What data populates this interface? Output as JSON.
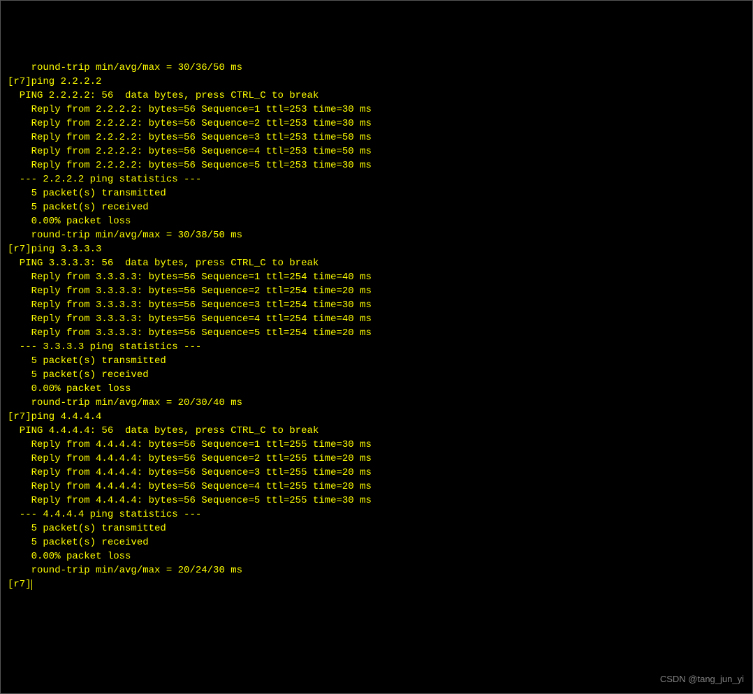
{
  "top_line": "    round-trip min/avg/max = 30/36/50 ms",
  "prompt_host": "r7",
  "pings": [
    {
      "cmd": "ping 2.2.2.2",
      "target": "2.2.2.2",
      "header": "PING 2.2.2.2: 56  data bytes, press CTRL_C to break",
      "replies": [
        {
          "seq": 1,
          "ttl": 253,
          "time": 30,
          "bytes": 56
        },
        {
          "seq": 2,
          "ttl": 253,
          "time": 30,
          "bytes": 56
        },
        {
          "seq": 3,
          "ttl": 253,
          "time": 50,
          "bytes": 56
        },
        {
          "seq": 4,
          "ttl": 253,
          "time": 50,
          "bytes": 56
        },
        {
          "seq": 5,
          "ttl": 253,
          "time": 30,
          "bytes": 56
        }
      ],
      "stats_header": "--- 2.2.2.2 ping statistics ---",
      "transmitted": 5,
      "received": 5,
      "loss": "0.00%",
      "rtt": "round-trip min/avg/max = 30/38/50 ms"
    },
    {
      "cmd": "ping 3.3.3.3",
      "target": "3.3.3.3",
      "header": "PING 3.3.3.3: 56  data bytes, press CTRL_C to break",
      "replies": [
        {
          "seq": 1,
          "ttl": 254,
          "time": 40,
          "bytes": 56
        },
        {
          "seq": 2,
          "ttl": 254,
          "time": 20,
          "bytes": 56
        },
        {
          "seq": 3,
          "ttl": 254,
          "time": 30,
          "bytes": 56
        },
        {
          "seq": 4,
          "ttl": 254,
          "time": 40,
          "bytes": 56
        },
        {
          "seq": 5,
          "ttl": 254,
          "time": 20,
          "bytes": 56
        }
      ],
      "stats_header": "--- 3.3.3.3 ping statistics ---",
      "transmitted": 5,
      "received": 5,
      "loss": "0.00%",
      "rtt": "round-trip min/avg/max = 20/30/40 ms"
    },
    {
      "cmd": "ping 4.4.4.4",
      "target": "4.4.4.4",
      "header": "PING 4.4.4.4: 56  data bytes, press CTRL_C to break",
      "replies": [
        {
          "seq": 1,
          "ttl": 255,
          "time": 30,
          "bytes": 56
        },
        {
          "seq": 2,
          "ttl": 255,
          "time": 20,
          "bytes": 56
        },
        {
          "seq": 3,
          "ttl": 255,
          "time": 20,
          "bytes": 56
        },
        {
          "seq": 4,
          "ttl": 255,
          "time": 20,
          "bytes": 56
        },
        {
          "seq": 5,
          "ttl": 255,
          "time": 30,
          "bytes": 56
        }
      ],
      "stats_header": "--- 4.4.4.4 ping statistics ---",
      "transmitted": 5,
      "received": 5,
      "loss": "0.00%",
      "rtt": "round-trip min/avg/max = 20/24/30 ms"
    }
  ],
  "labels": {
    "reply_prefix": "Reply from ",
    "bytes_prefix": ": bytes=",
    "seq_prefix": " Sequence=",
    "ttl_prefix": " ttl=",
    "time_prefix": " time=",
    "time_suffix": " ms",
    "transmitted_suffix": " packet(s) transmitted",
    "received_suffix": " packet(s) received",
    "loss_suffix": " packet loss"
  },
  "final_prompt": "[r7]",
  "watermark": "CSDN @tang_jun_yi"
}
